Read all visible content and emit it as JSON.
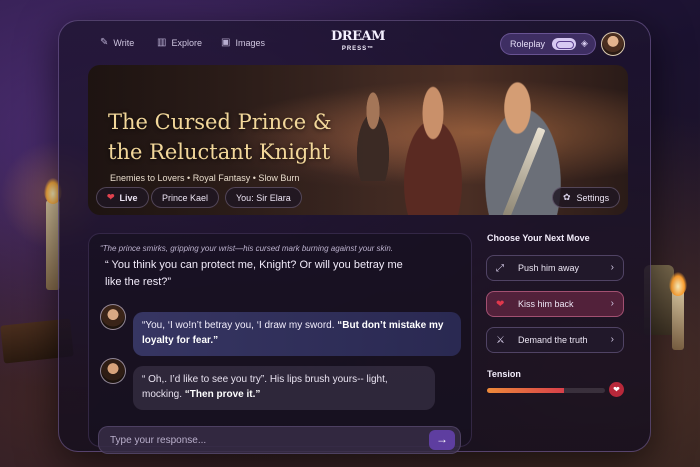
{
  "nav": {
    "write": "Write",
    "explore": "Explore",
    "images": "Images",
    "write_icon": "pencil-icon",
    "explore_icon": "book-icon",
    "images_icon": "image-icon"
  },
  "logo": {
    "main": "DREAM",
    "sub": "PRESS™"
  },
  "roleplay": {
    "label": "Roleplay",
    "enabled": true
  },
  "hero": {
    "title_line1": "The Cursed Prince &",
    "title_line2": "the Reluctant Knight",
    "subtitle": "Enemies to Lovers • Royal Fantasy • Slow Burn",
    "chips": {
      "live": "Live",
      "prince": "Prince Kael",
      "you": "You: Sir Elara",
      "settings": "Settings"
    }
  },
  "chat": {
    "narration": "“The prince smirks, gripping your wrist—his cursed mark burning against your skin.",
    "quote": "“ You think you can protect me, Knight? Or will you betray me like the rest?”",
    "messages": [
      {
        "pre": "“You, ‘I wo!n’t betray you, ‘I draw my sword. ",
        "bold": "“But don’t mistake my loyalty for fear.”"
      },
      {
        "pre": "“ Oh,. I’d like to see you try”. His lips brush yours-- light, mocking. ",
        "bold": "“Then prove it.”"
      }
    ],
    "input_placeholder": "Type your response...",
    "send_icon": "arrow-right-icon"
  },
  "moves": {
    "title": "Choose Your Next Move",
    "items": [
      {
        "label": "Push him away",
        "icon": "push-icon"
      },
      {
        "label": "Kiss him back",
        "icon": "heart-icon"
      },
      {
        "label": "Demand the truth",
        "icon": "swords-icon"
      }
    ]
  },
  "tension": {
    "label": "Tension",
    "value": 0.65
  },
  "colors": {
    "accent": "#5e3ea0",
    "heart": "#e0384c",
    "title_gold": "#f2d79a"
  }
}
